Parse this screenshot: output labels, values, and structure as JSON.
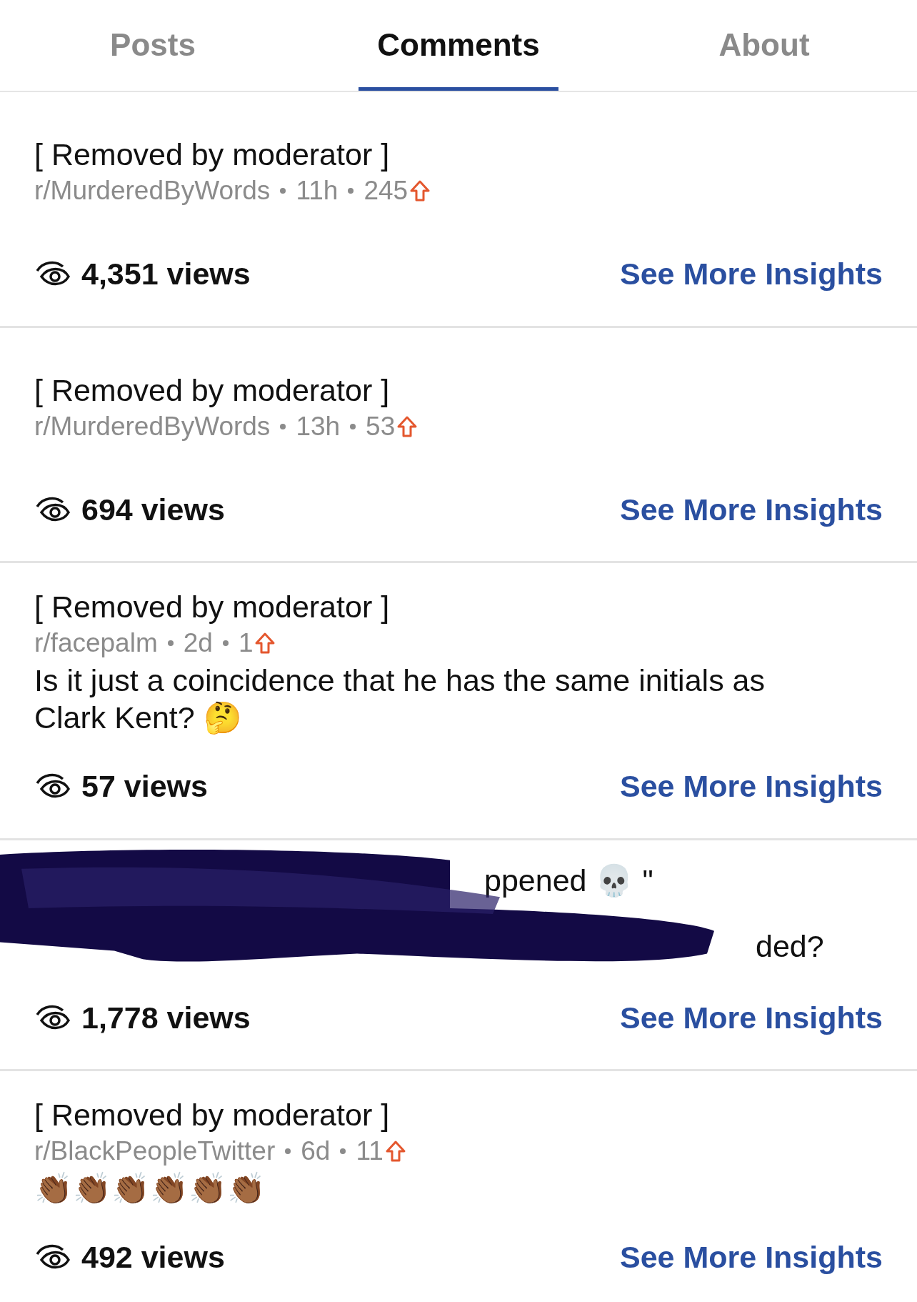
{
  "tabs": [
    {
      "label": "Posts",
      "selected": false
    },
    {
      "label": "Comments",
      "selected": true
    },
    {
      "label": "About",
      "selected": false
    }
  ],
  "comments": [
    {
      "kind": "comment",
      "title": "[ Removed by moderator ]",
      "subreddit": "r/MurderedByWords",
      "age": "11h",
      "score": "245",
      "views": "4,351 views",
      "insights": "See More Insights"
    },
    {
      "kind": "comment",
      "title": "[ Removed by moderator ]",
      "subreddit": "r/MurderedByWords",
      "age": "13h",
      "score": "53",
      "views": "694 views",
      "insights": "See More Insights"
    },
    {
      "kind": "comment",
      "title": "[ Removed by moderator ]",
      "subreddit": "r/facepalm",
      "age": "2d",
      "score": "1",
      "body": "Is it just a coincidence that he has the same initials as Clark Kent? 🤔",
      "views": "57 views",
      "insights": "See More Insights"
    },
    {
      "kind": "scribbled",
      "fragments": [
        "ppened 💀 \"",
        "ded?"
      ],
      "views": "1,778 views",
      "insights": "See More Insights"
    },
    {
      "kind": "comment",
      "title": "[ Removed by moderator ]",
      "subreddit": "r/BlackPeopleTwitter",
      "age": "6d",
      "score": "11",
      "body": "👏🏾👏🏾👏🏾👏🏾👏🏾👏🏾",
      "views": "492 views",
      "insights": "See More Insights"
    }
  ]
}
